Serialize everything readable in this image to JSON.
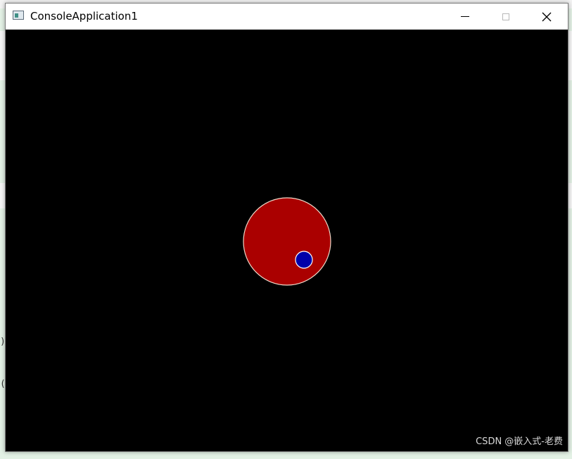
{
  "window": {
    "title": "ConsoleApplication1",
    "icon": "console-app-icon"
  },
  "caption_buttons": {
    "minimize": "minimize-icon",
    "maximize": "maximize-icon",
    "close": "close-icon"
  },
  "canvas": {
    "background_color": "#000000",
    "large_circle": {
      "fill": "#aa0000",
      "outline": "#f0d8c8"
    },
    "small_circle": {
      "fill": "#0000aa",
      "outline": "#ffffff"
    }
  },
  "background_editor": {
    "fragment_1": ")",
    "fragment_2": "("
  },
  "watermark": "CSDN @嵌入式-老费"
}
